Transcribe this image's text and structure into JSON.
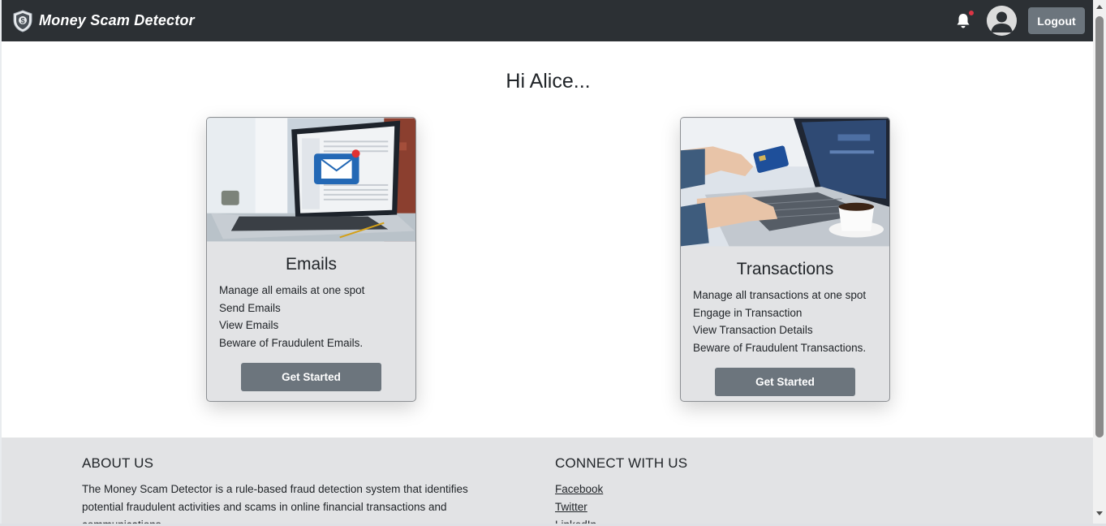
{
  "navbar": {
    "brand": "Money Scam Detector",
    "logout_label": "Logout",
    "icons": [
      "shield-logo-icon",
      "bell-icon",
      "user-avatar-icon"
    ],
    "colors": {
      "bar": "#2c3034",
      "notification_dot": "#dc3545",
      "button": "#6c757d"
    }
  },
  "main": {
    "greeting": "Hi Alice...",
    "cards": [
      {
        "title": "Emails",
        "lines": [
          "Manage all emails at one spot",
          "Send Emails",
          "View Emails",
          "Beware of Fraudulent Emails."
        ],
        "button": "Get Started",
        "image": "laptop-email-illustration"
      },
      {
        "title": "Transactions",
        "lines": [
          "Manage all transactions at one spot",
          "Engage in Transaction",
          "View Transaction Details",
          "Beware of Fraudulent Transactions."
        ],
        "button": "Get Started",
        "image": "laptop-credit-card-illustration"
      }
    ]
  },
  "footer": {
    "about_heading": "ABOUT US",
    "about_text": "The Money Scam Detector is a rule-based fraud detection system that identifies potential fraudulent activities and scams in online financial transactions and communications.",
    "connect_heading": "CONNECT WITH US",
    "links": [
      "Facebook",
      "Twitter",
      "LinkedIn"
    ]
  }
}
